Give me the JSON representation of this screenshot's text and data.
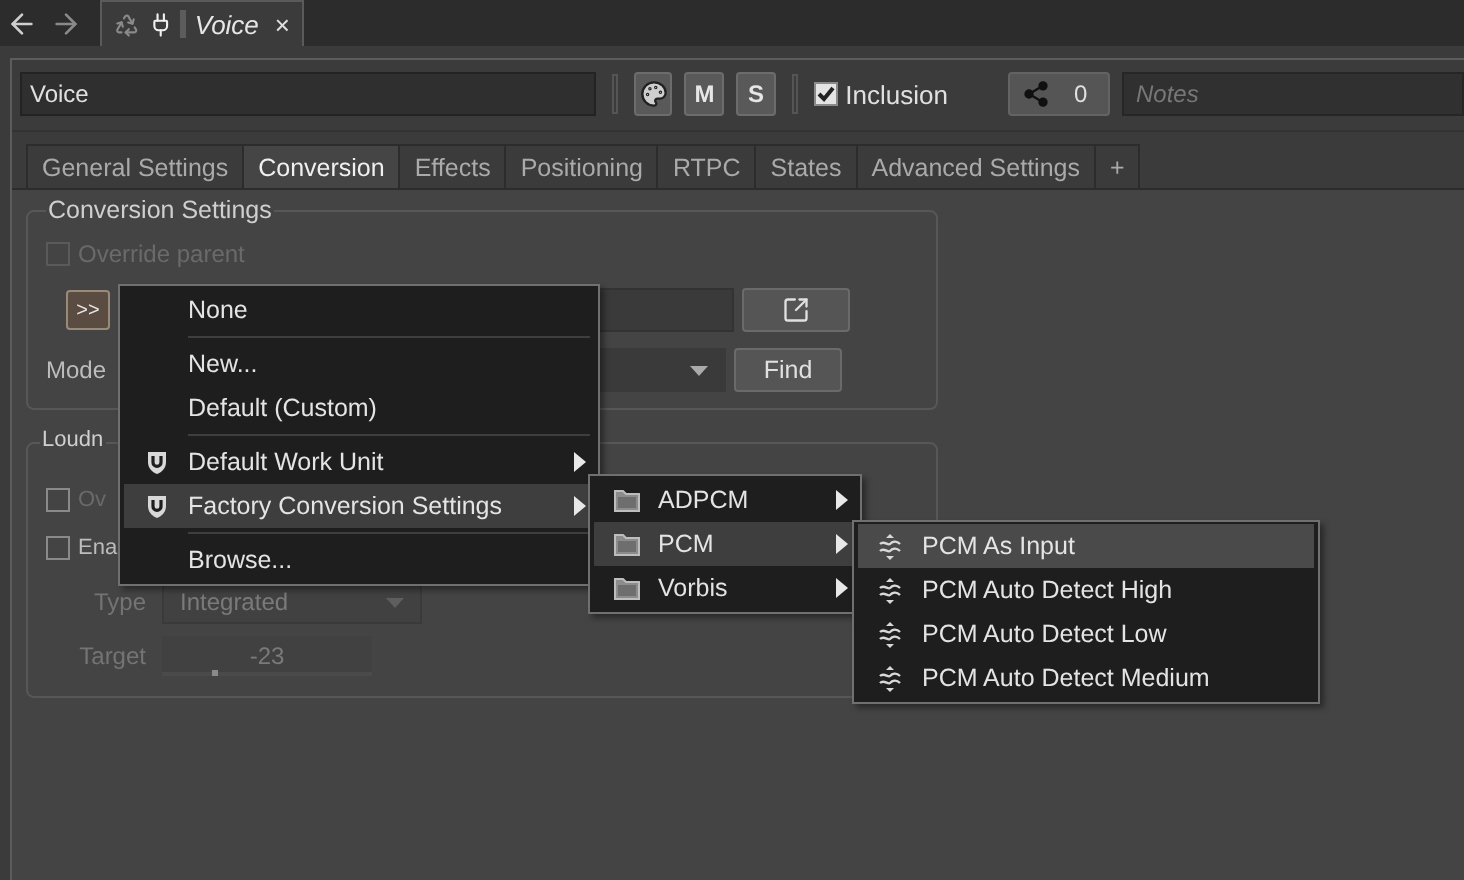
{
  "document_tab": {
    "title": "Voice",
    "close": "×"
  },
  "header": {
    "name": "Voice",
    "mute": "M",
    "solo": "S",
    "inclusion": {
      "label": "Inclusion",
      "checked": true
    },
    "references": "0",
    "notes": {
      "placeholder": "Notes"
    }
  },
  "tabs": [
    {
      "label": "General Settings",
      "selected": false
    },
    {
      "label": "Conversion",
      "selected": true
    },
    {
      "label": "Effects",
      "selected": false
    },
    {
      "label": "Positioning",
      "selected": false
    },
    {
      "label": "RTPC",
      "selected": false
    },
    {
      "label": "States",
      "selected": false
    },
    {
      "label": "Advanced Settings",
      "selected": false
    },
    {
      "label": "+",
      "selected": false
    }
  ],
  "conversion_settings": {
    "title": "Conversion Settings",
    "override_parent": {
      "label": "Override parent",
      "checked": false,
      "disabled": true
    },
    "browse_button": ">>",
    "mode_label": "Mode",
    "find_button": "Find"
  },
  "loudness": {
    "title": "Loudn",
    "override": {
      "label": "Ov",
      "checked": false
    },
    "enable": {
      "label": "Ena",
      "checked": false
    },
    "type_label": "Type",
    "type_value": "Integrated",
    "target": {
      "label": "Target",
      "value": "-23",
      "level": 0.25
    },
    "disabled": true
  },
  "menu": {
    "groups": [
      [
        {
          "label": "None",
          "kind": "plain",
          "submenu": false,
          "selected": false
        }
      ],
      [
        {
          "label": "New...",
          "kind": "plain",
          "submenu": false,
          "selected": false
        },
        {
          "label": "Default (Custom)",
          "kind": "plain",
          "submenu": false,
          "selected": false
        }
      ],
      [
        {
          "label": "Default Work Unit",
          "kind": "work_unit",
          "submenu": true,
          "selected": false
        },
        {
          "label": "Factory Conversion Settings",
          "kind": "work_unit",
          "submenu": true,
          "selected": true
        }
      ],
      [
        {
          "label": "Browse...",
          "kind": "plain",
          "submenu": false,
          "selected": false
        }
      ]
    ]
  },
  "submenu": {
    "items": [
      {
        "label": "ADPCM",
        "kind": "folder",
        "submenu": true,
        "selected": false
      },
      {
        "label": "PCM",
        "kind": "folder",
        "submenu": true,
        "selected": true
      },
      {
        "label": "Vorbis",
        "kind": "folder",
        "submenu": true,
        "selected": false
      }
    ]
  },
  "submenu_2": {
    "items": [
      {
        "label": "PCM As Input",
        "kind": "conversion",
        "submenu": false,
        "selected": true
      },
      {
        "label": "PCM Auto Detect High",
        "kind": "conversion",
        "submenu": false,
        "selected": false
      },
      {
        "label": "PCM Auto Detect Low",
        "kind": "conversion",
        "submenu": false,
        "selected": false
      },
      {
        "label": "PCM Auto Detect Medium",
        "kind": "conversion",
        "submenu": false,
        "selected": false
      }
    ]
  }
}
